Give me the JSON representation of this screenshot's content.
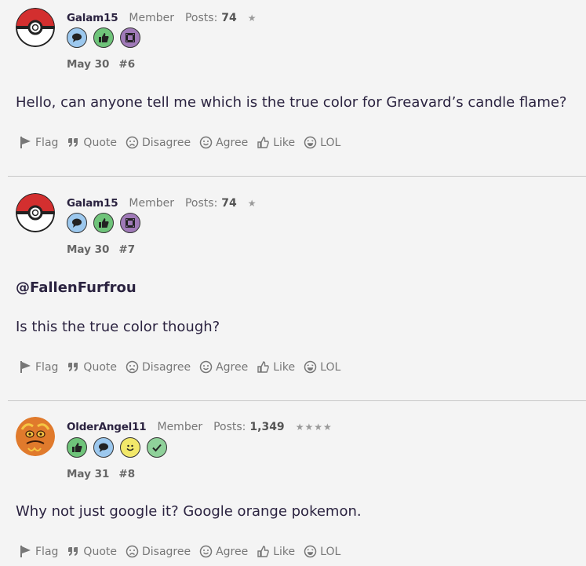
{
  "posts": [
    {
      "author": "Galam15",
      "role": "Member",
      "posts_label": "Posts:",
      "posts_count": "74",
      "stars": "★",
      "avatar": "pokeball-avatar",
      "badges": [
        "speech-bubble-badge",
        "thumbs-up-badge",
        "film-badge"
      ],
      "date": "May 30",
      "number": "#6",
      "mention": "",
      "body": "Hello, can anyone tell me which is the true color for Greavard’s candle flame?"
    },
    {
      "author": "Galam15",
      "role": "Member",
      "posts_label": "Posts:",
      "posts_count": "74",
      "stars": "★",
      "avatar": "pokeball-avatar",
      "badges": [
        "speech-bubble-badge",
        "thumbs-up-badge",
        "film-badge"
      ],
      "date": "May 30",
      "number": "#7",
      "mention": "@FallenFurfrou",
      "body": "Is this the true color though?"
    },
    {
      "author": "OlderAngel11",
      "role": "Member",
      "posts_label": "Posts:",
      "posts_count": "1,349",
      "stars": "★★★★",
      "avatar": "pokemon-art-avatar",
      "badges": [
        "thumbs-up-badge",
        "speech-bubble-badge",
        "smiley-badge",
        "checkmark-badge"
      ],
      "date": "May 31",
      "number": "#8",
      "mention": "",
      "body": "Why not just google it? Google orange pokemon."
    }
  ],
  "actions": {
    "flag": "Flag",
    "quote": "Quote",
    "disagree": "Disagree",
    "agree": "Agree",
    "like": "Like",
    "lol": "LOL"
  },
  "colors": {
    "badge_blue": "#9cc8ee",
    "badge_green": "#6fc47a",
    "badge_purple": "#a07ab8",
    "badge_yellow": "#f2e86a",
    "badge_check": "#8fd19a",
    "pokeball_red": "#d32f2f",
    "avatar_orange": "#e07a2c"
  }
}
